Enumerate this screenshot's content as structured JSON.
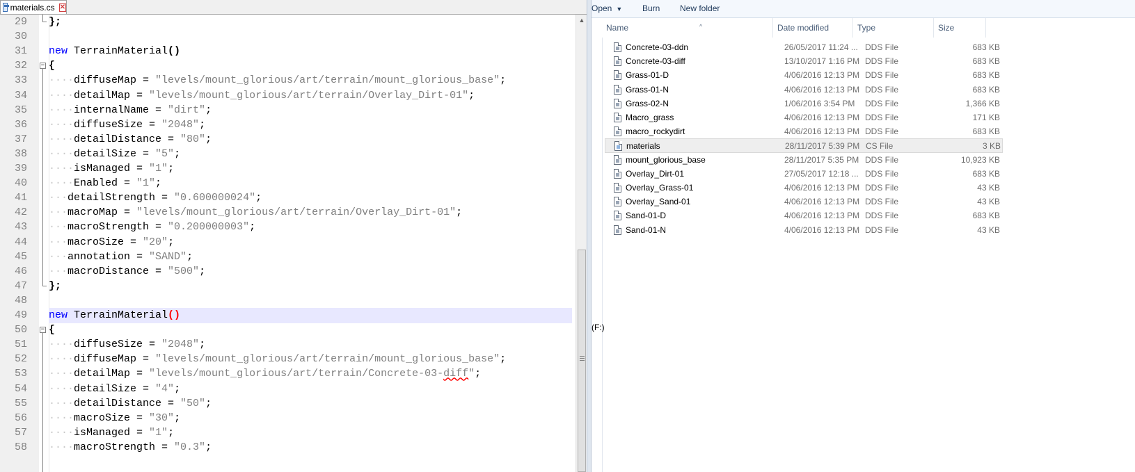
{
  "editor": {
    "tab_label": "materials.cs",
    "lines": [
      {
        "n": "29",
        "tokens": [
          {
            "t": "};",
            "c": "brace"
          }
        ],
        "fold": "end"
      },
      {
        "n": "30",
        "tokens": []
      },
      {
        "n": "31",
        "tokens": [
          {
            "t": "new",
            "c": "kw"
          },
          {
            "t": " TerrainMaterial",
            "c": "fn"
          },
          {
            "t": "()",
            "c": "paren"
          }
        ]
      },
      {
        "n": "32",
        "tokens": [
          {
            "t": "{",
            "c": "brace"
          }
        ],
        "fold": "start"
      },
      {
        "n": "33",
        "tokens": [
          {
            "t": "····",
            "c": "ws"
          },
          {
            "t": "diffuseMap = ",
            "c": "fn"
          },
          {
            "t": "\"levels/mount_glorious/art/terrain/mount_glorious_base\"",
            "c": "str"
          },
          {
            "t": ";",
            "c": "fn"
          }
        ]
      },
      {
        "n": "34",
        "tokens": [
          {
            "t": "····",
            "c": "ws"
          },
          {
            "t": "detailMap = ",
            "c": "fn"
          },
          {
            "t": "\"levels/mount_glorious/art/terrain/Overlay_Dirt-01\"",
            "c": "str"
          },
          {
            "t": ";",
            "c": "fn"
          }
        ]
      },
      {
        "n": "35",
        "tokens": [
          {
            "t": "····",
            "c": "ws"
          },
          {
            "t": "internalName = ",
            "c": "fn"
          },
          {
            "t": "\"dirt\"",
            "c": "str"
          },
          {
            "t": ";",
            "c": "fn"
          }
        ]
      },
      {
        "n": "36",
        "tokens": [
          {
            "t": "····",
            "c": "ws"
          },
          {
            "t": "diffuseSize = ",
            "c": "fn"
          },
          {
            "t": "\"2048\"",
            "c": "str"
          },
          {
            "t": ";",
            "c": "fn"
          }
        ]
      },
      {
        "n": "37",
        "tokens": [
          {
            "t": "····",
            "c": "ws"
          },
          {
            "t": "detailDistance = ",
            "c": "fn"
          },
          {
            "t": "\"80\"",
            "c": "str"
          },
          {
            "t": ";",
            "c": "fn"
          }
        ]
      },
      {
        "n": "38",
        "tokens": [
          {
            "t": "····",
            "c": "ws"
          },
          {
            "t": "detailSize = ",
            "c": "fn"
          },
          {
            "t": "\"5\"",
            "c": "str"
          },
          {
            "t": ";",
            "c": "fn"
          }
        ]
      },
      {
        "n": "39",
        "tokens": [
          {
            "t": "····",
            "c": "ws"
          },
          {
            "t": "isManaged = ",
            "c": "fn"
          },
          {
            "t": "\"1\"",
            "c": "str"
          },
          {
            "t": ";",
            "c": "fn"
          }
        ]
      },
      {
        "n": "40",
        "tokens": [
          {
            "t": "····",
            "c": "ws"
          },
          {
            "t": "Enabled = ",
            "c": "fn"
          },
          {
            "t": "\"1\"",
            "c": "str"
          },
          {
            "t": ";",
            "c": "fn"
          }
        ]
      },
      {
        "n": "41",
        "tokens": [
          {
            "t": "···",
            "c": "ws"
          },
          {
            "t": "detailStrength = ",
            "c": "fn"
          },
          {
            "t": "\"0.600000024\"",
            "c": "str"
          },
          {
            "t": ";",
            "c": "fn"
          }
        ]
      },
      {
        "n": "42",
        "tokens": [
          {
            "t": "···",
            "c": "ws"
          },
          {
            "t": "macroMap = ",
            "c": "fn"
          },
          {
            "t": "\"levels/mount_glorious/art/terrain/Overlay_Dirt-01\"",
            "c": "str"
          },
          {
            "t": ";",
            "c": "fn"
          }
        ]
      },
      {
        "n": "43",
        "tokens": [
          {
            "t": "···",
            "c": "ws"
          },
          {
            "t": "macroStrength = ",
            "c": "fn"
          },
          {
            "t": "\"0.200000003\"",
            "c": "str"
          },
          {
            "t": ";",
            "c": "fn"
          }
        ]
      },
      {
        "n": "44",
        "tokens": [
          {
            "t": "···",
            "c": "ws"
          },
          {
            "t": "macroSize = ",
            "c": "fn"
          },
          {
            "t": "\"20\"",
            "c": "str"
          },
          {
            "t": ";",
            "c": "fn"
          }
        ]
      },
      {
        "n": "45",
        "tokens": [
          {
            "t": "···",
            "c": "ws"
          },
          {
            "t": "annotation = ",
            "c": "fn"
          },
          {
            "t": "\"SAND\"",
            "c": "str"
          },
          {
            "t": ";",
            "c": "fn"
          }
        ]
      },
      {
        "n": "46",
        "tokens": [
          {
            "t": "···",
            "c": "ws"
          },
          {
            "t": "macroDistance = ",
            "c": "fn"
          },
          {
            "t": "\"500\"",
            "c": "str"
          },
          {
            "t": ";",
            "c": "fn"
          }
        ]
      },
      {
        "n": "47",
        "tokens": [
          {
            "t": "};",
            "c": "brace"
          }
        ],
        "fold": "end"
      },
      {
        "n": "48",
        "tokens": []
      },
      {
        "n": "49",
        "tokens": [
          {
            "t": "new",
            "c": "kw"
          },
          {
            "t": " TerrainMaterial",
            "c": "fn"
          },
          {
            "t": "()",
            "c": "paren hl"
          }
        ],
        "current": true
      },
      {
        "n": "50",
        "tokens": [
          {
            "t": "{",
            "c": "brace"
          }
        ],
        "fold": "start"
      },
      {
        "n": "51",
        "tokens": [
          {
            "t": "····",
            "c": "ws"
          },
          {
            "t": "diffuseSize = ",
            "c": "fn"
          },
          {
            "t": "\"2048\"",
            "c": "str"
          },
          {
            "t": ";",
            "c": "fn"
          }
        ]
      },
      {
        "n": "52",
        "tokens": [
          {
            "t": "····",
            "c": "ws"
          },
          {
            "t": "diffuseMap = ",
            "c": "fn"
          },
          {
            "t": "\"levels/mount_glorious/art/terrain/mount_glorious_base\"",
            "c": "str"
          },
          {
            "t": ";",
            "c": "fn"
          }
        ]
      },
      {
        "n": "53",
        "tokens": [
          {
            "t": "····",
            "c": "ws"
          },
          {
            "t": "detailMap = ",
            "c": "fn"
          },
          {
            "t": "\"levels/mount_glorious/art/terrain/Concrete-03-",
            "c": "str"
          },
          {
            "t": "diff",
            "c": "str squiggle"
          },
          {
            "t": "\"",
            "c": "str"
          },
          {
            "t": ";",
            "c": "fn"
          }
        ]
      },
      {
        "n": "54",
        "tokens": [
          {
            "t": "····",
            "c": "ws"
          },
          {
            "t": "detailSize = ",
            "c": "fn"
          },
          {
            "t": "\"4\"",
            "c": "str"
          },
          {
            "t": ";",
            "c": "fn"
          }
        ]
      },
      {
        "n": "55",
        "tokens": [
          {
            "t": "····",
            "c": "ws"
          },
          {
            "t": "detailDistance = ",
            "c": "fn"
          },
          {
            "t": "\"50\"",
            "c": "str"
          },
          {
            "t": ";",
            "c": "fn"
          }
        ]
      },
      {
        "n": "56",
        "tokens": [
          {
            "t": "····",
            "c": "ws"
          },
          {
            "t": "macroSize = ",
            "c": "fn"
          },
          {
            "t": "\"30\"",
            "c": "str"
          },
          {
            "t": ";",
            "c": "fn"
          }
        ]
      },
      {
        "n": "57",
        "tokens": [
          {
            "t": "····",
            "c": "ws"
          },
          {
            "t": "isManaged = ",
            "c": "fn"
          },
          {
            "t": "\"1\"",
            "c": "str"
          },
          {
            "t": ";",
            "c": "fn"
          }
        ]
      },
      {
        "n": "58",
        "tokens": [
          {
            "t": "····",
            "c": "ws"
          },
          {
            "t": "macroStrength = ",
            "c": "fn"
          },
          {
            "t": "\"0.3\"",
            "c": "str"
          },
          {
            "t": ";",
            "c": "fn"
          }
        ]
      }
    ]
  },
  "explorer": {
    "toolbar": {
      "open": "Open",
      "burn": "Burn",
      "new_folder": "New folder"
    },
    "nav_label": "(F:)",
    "columns": {
      "name": "Name",
      "date": "Date modified",
      "type": "Type",
      "size": "Size"
    },
    "files": [
      {
        "name": "Concrete-03-ddn",
        "date": "26/05/2017 11:24 ...",
        "type": "DDS File",
        "size": "683 KB",
        "icon": "dds-file-icon"
      },
      {
        "name": "Concrete-03-diff",
        "date": "13/10/2017 1:16 PM",
        "type": "DDS File",
        "size": "683 KB",
        "icon": "dds-file-icon"
      },
      {
        "name": "Grass-01-D",
        "date": "4/06/2016 12:13 PM",
        "type": "DDS File",
        "size": "683 KB",
        "icon": "dds-file-icon"
      },
      {
        "name": "Grass-01-N",
        "date": "4/06/2016 12:13 PM",
        "type": "DDS File",
        "size": "683 KB",
        "icon": "dds-file-icon"
      },
      {
        "name": "Grass-02-N",
        "date": "1/06/2016 3:54 PM",
        "type": "DDS File",
        "size": "1,366 KB",
        "icon": "dds-file-icon"
      },
      {
        "name": "Macro_grass",
        "date": "4/06/2016 12:13 PM",
        "type": "DDS File",
        "size": "171 KB",
        "icon": "dds-file-icon"
      },
      {
        "name": "macro_rockydirt",
        "date": "4/06/2016 12:13 PM",
        "type": "DDS File",
        "size": "683 KB",
        "icon": "dds-file-icon"
      },
      {
        "name": "materials",
        "date": "28/11/2017 5:39 PM",
        "type": "CS File",
        "size": "3 KB",
        "icon": "cs-file-icon",
        "selected": true
      },
      {
        "name": "mount_glorious_base",
        "date": "28/11/2017 5:35 PM",
        "type": "DDS File",
        "size": "10,923 KB",
        "icon": "dds-file-icon"
      },
      {
        "name": "Overlay_Dirt-01",
        "date": "27/05/2017 12:18 ...",
        "type": "DDS File",
        "size": "683 KB",
        "icon": "dds-file-icon"
      },
      {
        "name": "Overlay_Grass-01",
        "date": "4/06/2016 12:13 PM",
        "type": "DDS File",
        "size": "43 KB",
        "icon": "dds-file-icon"
      },
      {
        "name": "Overlay_Sand-01",
        "date": "4/06/2016 12:13 PM",
        "type": "DDS File",
        "size": "43 KB",
        "icon": "dds-file-icon"
      },
      {
        "name": "Sand-01-D",
        "date": "4/06/2016 12:13 PM",
        "type": "DDS File",
        "size": "683 KB",
        "icon": "dds-file-icon"
      },
      {
        "name": "Sand-01-N",
        "date": "4/06/2016 12:13 PM",
        "type": "DDS File",
        "size": "43 KB",
        "icon": "dds-file-icon"
      }
    ]
  }
}
